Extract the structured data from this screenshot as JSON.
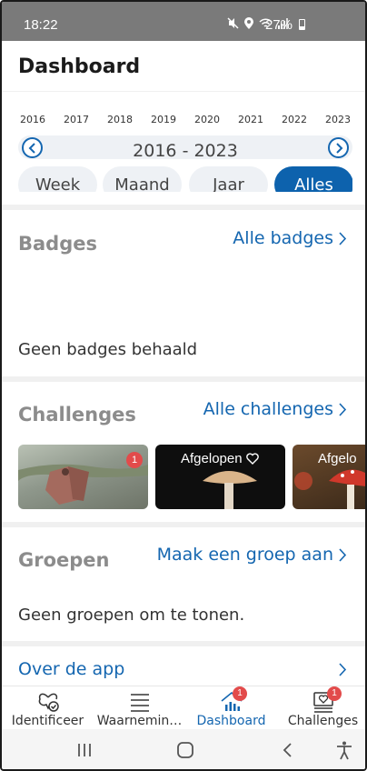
{
  "status_bar": {
    "time": "18:22",
    "battery": "27%"
  },
  "header": {
    "title": "Dashboard"
  },
  "year_selector": {
    "years": [
      "2016",
      "2017",
      "2018",
      "2019",
      "2020",
      "2021",
      "2022",
      "2023"
    ],
    "range_label": "2016 - 2023",
    "periods": [
      "Week",
      "Maand",
      "Jaar",
      "Alles"
    ],
    "active_period": "Alles"
  },
  "badges": {
    "title": "Badges",
    "link": "Alle badges",
    "empty_text": "Geen badges behaald"
  },
  "challenges": {
    "title": "Challenges",
    "link": "Alle challenges",
    "items": [
      {
        "label": "",
        "badge": "1"
      },
      {
        "label": "Afgelopen",
        "badge": ""
      },
      {
        "label": "Afgelo",
        "badge": ""
      }
    ]
  },
  "groups": {
    "title": "Groepen",
    "link": "Maak een groep aan",
    "empty_text": "Geen groepen om te tonen."
  },
  "about": {
    "link": "Over de app"
  },
  "bottom_nav": {
    "items": [
      {
        "label": "Identificeer",
        "icon": "butterfly-check-icon",
        "badge": ""
      },
      {
        "label": "Waarnemin…",
        "icon": "list-icon",
        "badge": ""
      },
      {
        "label": "Dashboard",
        "icon": "house-chart-icon",
        "badge": "1"
      },
      {
        "label": "Challenges",
        "icon": "heart-inbox-icon",
        "badge": "1"
      }
    ],
    "active": "Dashboard"
  },
  "colors": {
    "accent": "#1466b0",
    "active_pill": "#0d62ad",
    "badge": "#e24b4b",
    "muted_title": "#8c8c8c"
  }
}
